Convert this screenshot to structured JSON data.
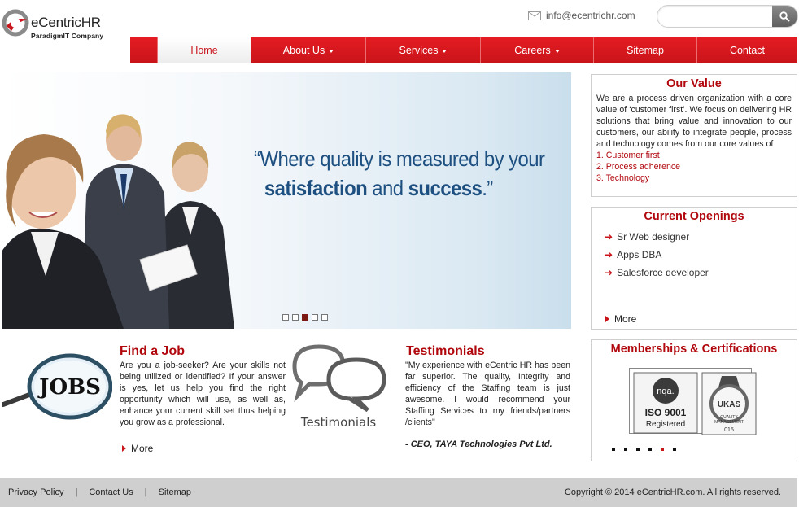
{
  "brand": {
    "name": "eCentricHR",
    "tagline": "ParadigmIT Company"
  },
  "header": {
    "email": "info@ecentrichr.com",
    "search_placeholder": ""
  },
  "nav": {
    "items": [
      {
        "label": "Home",
        "active": true,
        "dropdown": false
      },
      {
        "label": "About Us",
        "active": false,
        "dropdown": true
      },
      {
        "label": "Services",
        "active": false,
        "dropdown": true
      },
      {
        "label": "Careers",
        "active": false,
        "dropdown": true
      },
      {
        "label": "Sitemap",
        "active": false,
        "dropdown": false
      },
      {
        "label": "Contact",
        "active": false,
        "dropdown": false
      }
    ]
  },
  "hero": {
    "quote_line1": "“Where quality is measured by your",
    "quote_line2a": "satisfaction",
    "quote_line2b": " and ",
    "quote_line2c": "success",
    "quote_line2d": ".”",
    "slides": 5,
    "active_slide": 3
  },
  "our_value": {
    "title": "Our Value",
    "text": "We are a process driven organization with a core value of ‘customer first’. We focus on delivering HR solutions that bring value and innovation to our customers, our ability to integrate people, process and technology comes from our core values of",
    "items": [
      "1. Customer first",
      "2. Process adherence",
      "3. Technology"
    ]
  },
  "openings": {
    "title": "Current Openings",
    "jobs": [
      "Sr Web designer",
      "Apps DBA",
      "Salesforce developer"
    ],
    "more": "More"
  },
  "memberships": {
    "title": "Memberships & Certifications",
    "cert_labels": [
      "nqa.",
      "ISO 9001",
      "Registered",
      "UKAS",
      "QUALITY",
      "MANAGEMENT",
      "015"
    ],
    "dots": 6,
    "active_dot": 5
  },
  "find_job": {
    "title": "Find a Job",
    "image_text": "JOBS",
    "text": "Are you a job-seeker? Are your skills not being utilized or identified? If your answer is yes, let us help you find the right opportunity which will use, as well as, enhance your current skill set thus helping you grow as a professional.",
    "more": "More"
  },
  "testimonials": {
    "title": "Testimonials",
    "image_text": "Testimonials",
    "text": "\"My experience with eCentric HR has been far superior. The quality, Integrity and efficiency of the Staffing team is just awesome. I would recommend your Staffing Services to my friends/partners /clients\"",
    "author": "- CEO, TAYA Technologies Pvt Ltd."
  },
  "footer": {
    "links": [
      "Privacy Policy",
      "Contact Us",
      "Sitemap"
    ],
    "separator": "|",
    "copyright": "Copyright © 2014 eCentricHR.com. All rights reserved."
  },
  "colors": {
    "brand_red": "#d7151c",
    "heading_red": "#b1080e",
    "quote_blue": "#1d4f80",
    "footer_gray": "#cfcfcf"
  }
}
